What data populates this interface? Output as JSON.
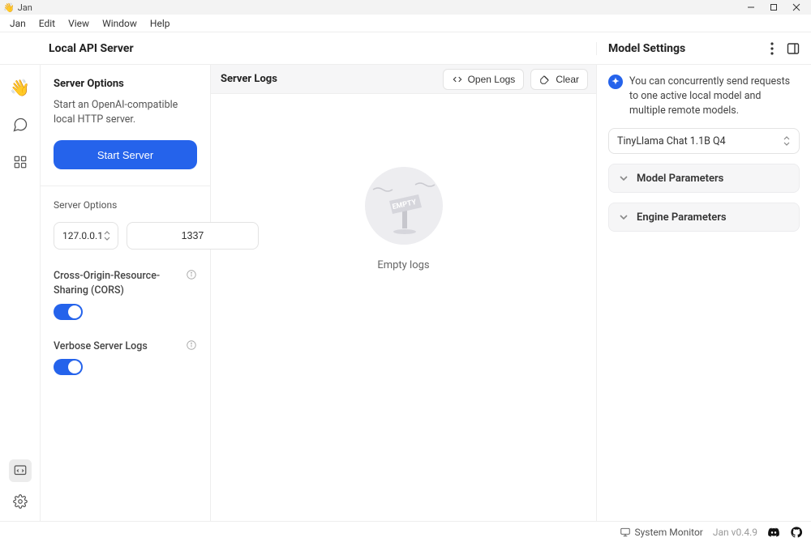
{
  "window": {
    "title": "Jan"
  },
  "menu": {
    "items": [
      "Jan",
      "Edit",
      "View",
      "Window",
      "Help"
    ]
  },
  "header": {
    "page_title": "Local API Server",
    "right_title": "Model Settings"
  },
  "left": {
    "section_title": "Server Options",
    "section_sub": "Start an OpenAI-compatible local HTTP server.",
    "start_label": "Start Server",
    "options_label": "Server Options",
    "ip_value": "127.0.0.1",
    "port_value": "1337",
    "cors_label": "Cross-Origin-Resource-Sharing (CORS)",
    "verbose_label": "Verbose Server Logs"
  },
  "center": {
    "logs_title": "Server Logs",
    "open_logs": "Open Logs",
    "clear": "Clear",
    "empty": "Empty logs",
    "empty_badge": "EMPTY"
  },
  "right": {
    "banner": "You can concurrently send requests to one active local model and multiple remote models.",
    "model_value": "TinyLlama Chat 1.1B Q4",
    "acc1": "Model Parameters",
    "acc2": "Engine Parameters"
  },
  "status": {
    "system_monitor": "System Monitor",
    "version": "Jan v0.4.9"
  }
}
